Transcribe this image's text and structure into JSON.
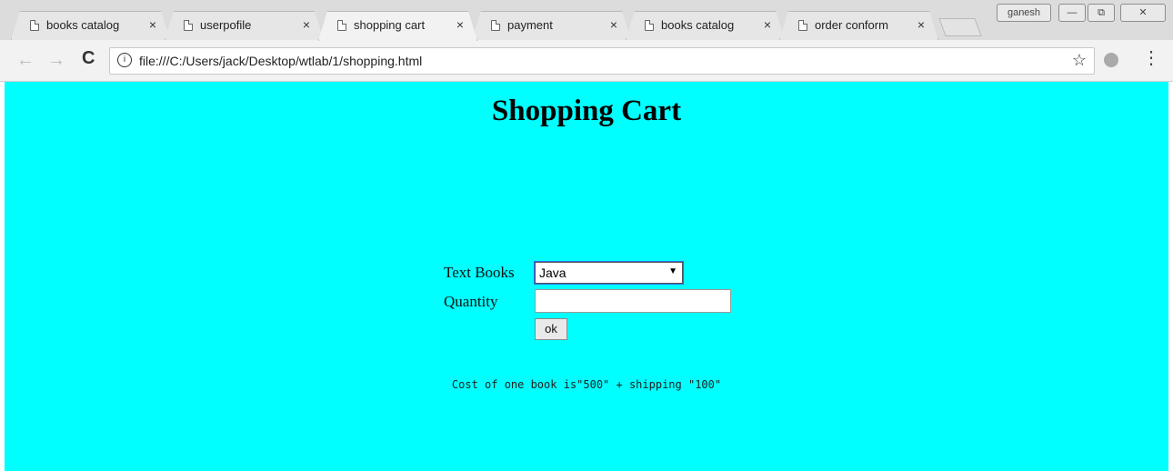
{
  "browser": {
    "tabs": [
      {
        "title": "books catalog",
        "close": "×"
      },
      {
        "title": "userpofile",
        "close": "×"
      },
      {
        "title": "shopping cart",
        "close": "×",
        "active": true
      },
      {
        "title": "payment",
        "close": "×"
      },
      {
        "title": "books catalog",
        "close": "×"
      },
      {
        "title": "order conform",
        "close": "×"
      }
    ],
    "profile_name": "ganesh",
    "window_buttons": {
      "minimize": "—",
      "restore": "⧉",
      "close": "✕"
    },
    "nav": {
      "back": "←",
      "forward": "→",
      "reload": "C"
    },
    "address": {
      "info_icon": "i",
      "url": "file:///C:/Users/jack/Desktop/wtlab/1/shopping.html",
      "star": "☆"
    },
    "menu_icon": "⋮"
  },
  "page": {
    "background": "#00ffff",
    "title": "Shopping Cart",
    "form": {
      "textbooks_label": "Text Books",
      "textbooks_selected": "Java",
      "quantity_label": "Quantity",
      "quantity_value": "",
      "ok_label": "ok"
    },
    "cost_note": "Cost of one book is\"500\" + shipping \"100\""
  }
}
